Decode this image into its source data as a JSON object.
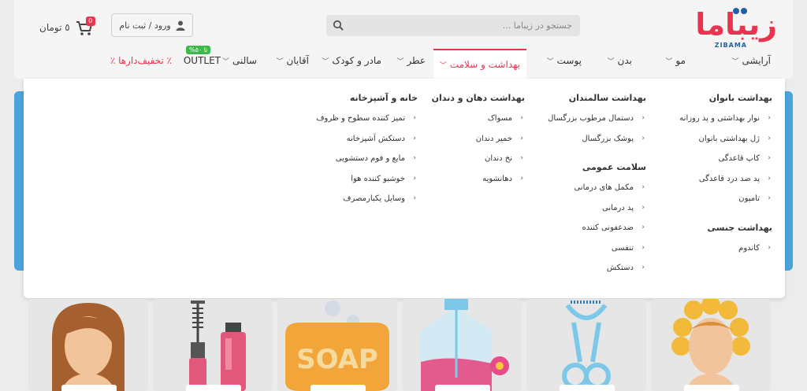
{
  "header": {
    "logo_text": "زیباما",
    "logo_sub": "ZIBAMA",
    "search_placeholder": "جستجو در زیباما ...",
    "login_label": "ورود / ثبت نام",
    "cart_count": "0",
    "cart_label": "٥ تومان"
  },
  "nav": {
    "items": [
      {
        "label": "آرایشی"
      },
      {
        "label": "مو"
      },
      {
        "label": "بدن"
      },
      {
        "label": "پوست"
      },
      {
        "label": "بهداشت و سلامت"
      },
      {
        "label": "عطر"
      },
      {
        "label": "مادر و کودک"
      },
      {
        "label": "آقایان"
      },
      {
        "label": "سالنی"
      },
      {
        "label": "OUTLET"
      },
      {
        "label": "٪ تخفیف‌دارها ٪"
      }
    ],
    "outlet_badge": "تا ٥٠%"
  },
  "mega": {
    "col1": {
      "title": "بهداشت بانوان",
      "items": [
        "نوار بهداشتی و پد روزانه",
        "ژل بهداشتی بانوان",
        "کاپ قاعدگی",
        "پد ضد درد قاعدگی",
        "تامپون"
      ],
      "sub_title": "بهداشت جنسی",
      "sub_items": [
        "کاندوم"
      ]
    },
    "col2": {
      "title": "بهداشت سالمندان",
      "items": [
        "دستمال مرطوب بزرگسال",
        "پوشک بزرگسال"
      ],
      "sub_title": "سلامت عمومی",
      "sub_items": [
        "مکمل های درمانی",
        "پد درمانی",
        "ضدعفونی کننده",
        "تنفسی",
        "دستکش"
      ]
    },
    "col3": {
      "title": "بهداشت دهان و دندان",
      "items": [
        "مسواک",
        "خمیر دندان",
        "نخ دندان",
        "دهانشویه"
      ]
    },
    "col4": {
      "title": "خانه و آشپزخانه",
      "items": [
        "تمیز کننده سطوح و ظروف",
        "دستکش آشپزخانه",
        "مایع و فوم دستشویی",
        "خوشبو کننده هوا",
        "وسایل یکبارمصرف"
      ]
    }
  },
  "products": {
    "soap_text": "SOAP"
  },
  "colors": {
    "brand": "#e8344e",
    "brand_blue": "#1f5fa8",
    "outlet_green": "#3cb94a"
  }
}
